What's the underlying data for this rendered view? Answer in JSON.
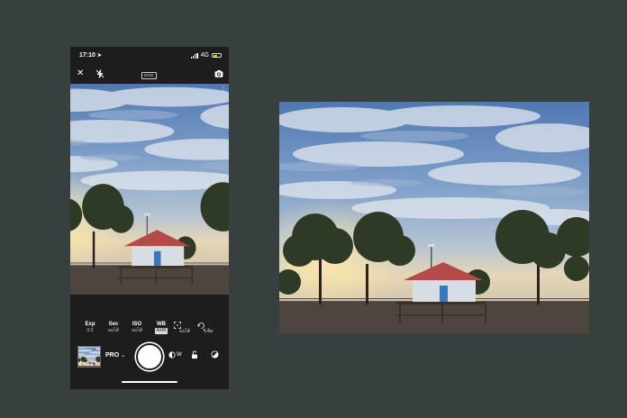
{
  "status_bar": {
    "time": "17:10",
    "location_arrow": "➤",
    "network": "4G",
    "battery_color": "#e8c21c"
  },
  "top_bar": {
    "close_label": "✕",
    "format_badge": "DNG"
  },
  "controls": [
    {
      "label": "Exp",
      "value": "0.0"
    },
    {
      "label": "Sec",
      "value": "ออโต้"
    },
    {
      "label": "ISO",
      "value": "ออโต้"
    },
    {
      "label": "WB",
      "value": "AWB"
    },
    {
      "label": "",
      "value": "ออโต้",
      "icon": "focus-icon"
    },
    {
      "label": "",
      "value": "รีเซ็ต",
      "icon": "reset-icon"
    }
  ],
  "bottom_bar": {
    "mode": "PRO",
    "mode_chevron": "⌄",
    "wb_letter": "W"
  },
  "colors": {
    "background": "#38403f",
    "phone": "#1d1d1d",
    "sky": "#5d86bd",
    "roof": "#b44b48"
  }
}
